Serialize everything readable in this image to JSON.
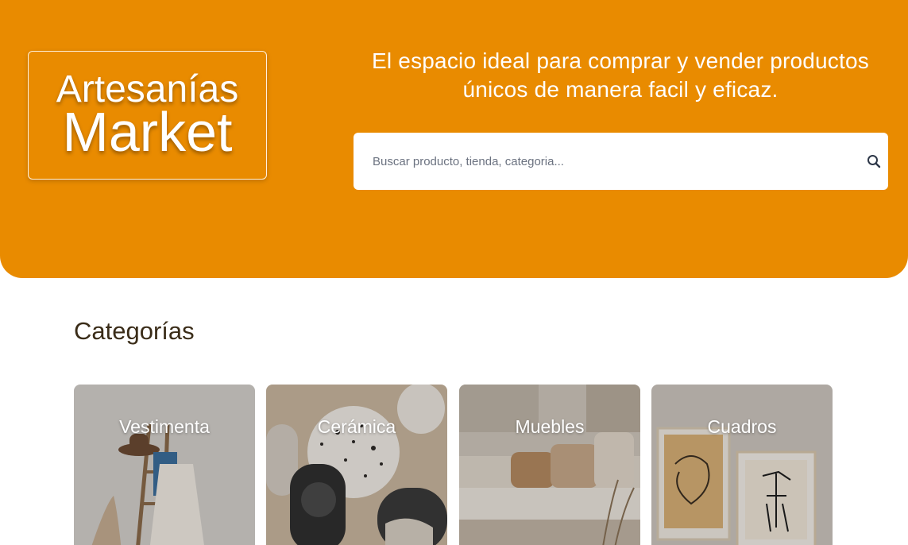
{
  "hero": {
    "logo_line1": "Artesanías",
    "logo_line2": "Market",
    "tagline": "El espacio ideal para comprar y vender productos únicos de manera facil y eficaz.",
    "search_placeholder": "Buscar producto, tienda, categoria...",
    "search_value": "",
    "accent_color": "#e98b00"
  },
  "categories": {
    "title": "Categorías",
    "items": [
      {
        "label": "Vestimenta",
        "image": "clothing-rack-photo"
      },
      {
        "label": "Cerámica",
        "image": "ceramic-dishes-photo"
      },
      {
        "label": "Muebles",
        "image": "living-room-photo"
      },
      {
        "label": "Cuadros",
        "image": "framed-art-photo"
      }
    ]
  }
}
